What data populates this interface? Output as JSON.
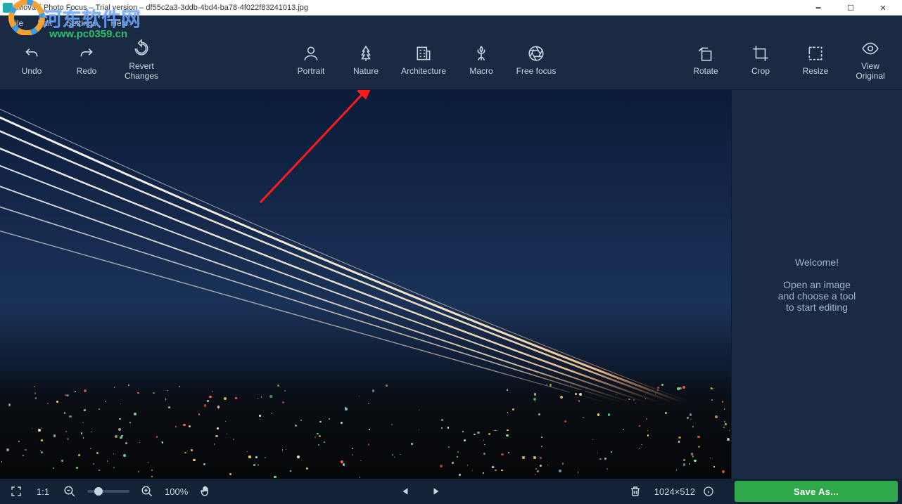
{
  "window": {
    "title": "Movavi Photo Focus – Trial version – df55c2a3-3ddb-4bd4-ba78-4f022f83241013.jpg"
  },
  "menu": {
    "file": "File",
    "edit": "Edit",
    "settings": "Settings",
    "help": "Help"
  },
  "watermark": {
    "cn": "河东软件网",
    "url": "www.pc0359.cn"
  },
  "toolbar": {
    "undo": "Undo",
    "redo": "Redo",
    "revert": "Revert\nChanges",
    "portrait": "Portrait",
    "nature": "Nature",
    "architecture": "Architecture",
    "macro": "Macro",
    "freefocus": "Free focus",
    "rotate": "Rotate",
    "crop": "Crop",
    "resize": "Resize",
    "view_original": "View\nOriginal"
  },
  "panel": {
    "welcome": "Welcome!",
    "hint": "Open an image\nand choose a tool\nto start editing"
  },
  "bottom": {
    "onetoone": "1:1",
    "zoom_pct": "100%",
    "dimensions": "1024×512",
    "save": "Save As..."
  }
}
